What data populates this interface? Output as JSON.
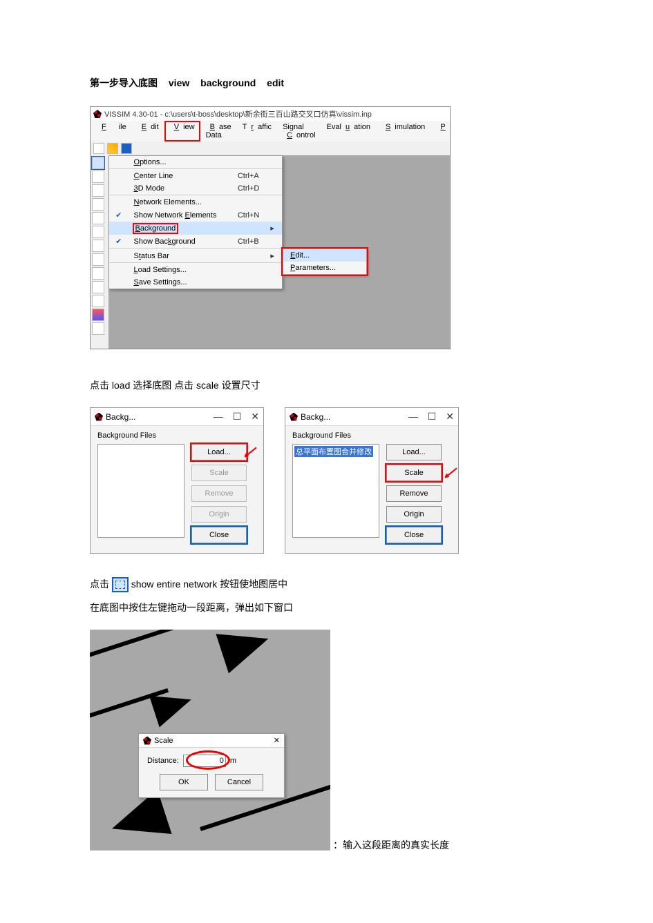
{
  "intro": {
    "prefix": "第一步导入底图",
    "menu1": "view",
    "menu2": "background",
    "menu3": "edit"
  },
  "vissim": {
    "title": "VISSIM 4.30-01 - c:\\users\\t-boss\\desktop\\新余街三百山路交叉口仿真\\vissim.inp",
    "menus": [
      "File",
      "Edit",
      "View",
      "Base Data",
      "Traffic",
      "Signal Control",
      "Evaluation",
      "Simulation",
      "P"
    ],
    "dropdown": [
      {
        "chk": "",
        "label": "Options...",
        "short": "",
        "arrow": ""
      },
      {
        "sep": true
      },
      {
        "chk": "",
        "label": "Center Line",
        "short": "Ctrl+A",
        "arrow": ""
      },
      {
        "chk": "",
        "label": "3D Mode",
        "short": "Ctrl+D",
        "arrow": ""
      },
      {
        "sep": true
      },
      {
        "chk": "",
        "label": "Network Elements...",
        "short": "",
        "arrow": ""
      },
      {
        "chk": "✔",
        "label": "Show Network Elements",
        "short": "Ctrl+N",
        "arrow": ""
      },
      {
        "chk": "",
        "label": "Background",
        "short": "",
        "arrow": "▸",
        "hl": true,
        "boxed": true
      },
      {
        "chk": "✔",
        "label": "Show Background",
        "short": "Ctrl+B",
        "arrow": ""
      },
      {
        "sep": true
      },
      {
        "chk": "",
        "label": "Status Bar",
        "short": "",
        "arrow": "▸"
      },
      {
        "sep": true
      },
      {
        "chk": "",
        "label": "Load Settings...",
        "short": "",
        "arrow": ""
      },
      {
        "chk": "",
        "label": "Save Settings...",
        "short": "",
        "arrow": ""
      }
    ],
    "submenu": [
      "Edit...",
      "Parameters..."
    ]
  },
  "line2": "点击 load  选择底图   点击 scale 设置尺寸",
  "dlg": {
    "title": "Backg...",
    "label": "Background Files",
    "file_entry": "总平面布置图合并修改",
    "buttons": {
      "load": "Load...",
      "scale": "Scale",
      "remove": "Remove",
      "origin": "Origin",
      "close": "Close"
    }
  },
  "line3a": "点击",
  "line3b": "show entire network 按钮使地图居中",
  "line4": "在底图中按住左键拖动一段距离，弹出如下窗口",
  "scale": {
    "title": "Scale",
    "label": "Distance:",
    "value": "0",
    "unit": "m",
    "ok": "OK",
    "cancel": "Cancel"
  },
  "caption": "：输入这段距离的真实长度"
}
